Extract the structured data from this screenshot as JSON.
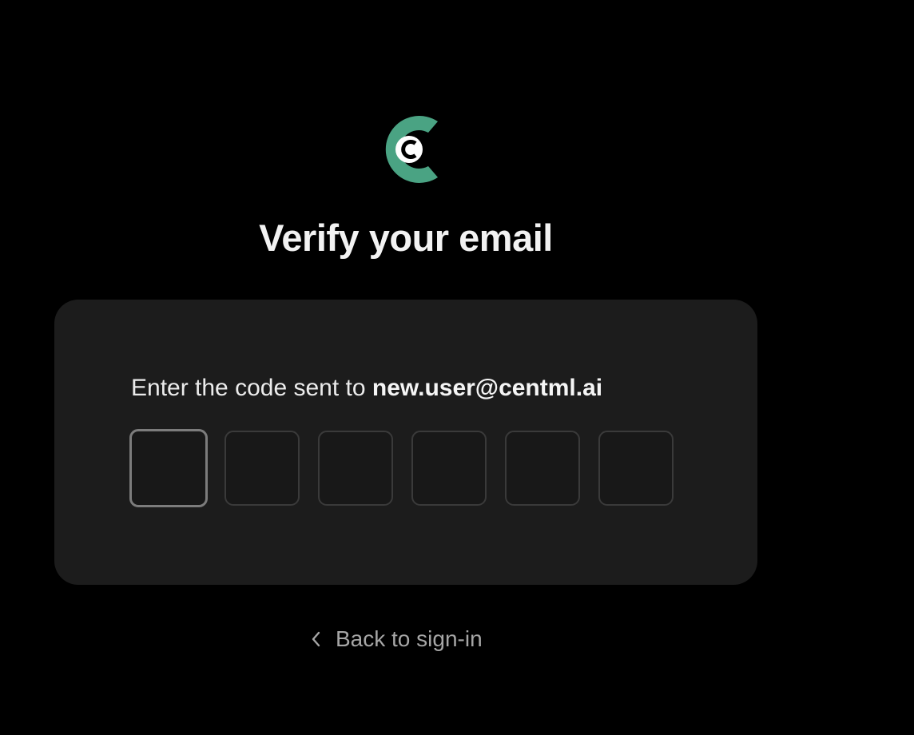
{
  "logo": {
    "name": "CentML logo",
    "accent": "#4aa383",
    "inner": "#ffffff"
  },
  "title": "Verify your email",
  "card": {
    "prompt_prefix": "Enter the code sent to ",
    "email": "new.user@centml.ai",
    "code_digits": [
      "",
      "",
      "",
      "",
      "",
      ""
    ]
  },
  "back_link": {
    "icon": "chevron-left-icon",
    "label": "Back to sign-in"
  },
  "colors": {
    "background": "#000000",
    "card": "#1c1c1c",
    "box_border": "#3a3a3a",
    "box_border_active": "#7c7c7c",
    "muted_text": "#a6a6a6"
  }
}
